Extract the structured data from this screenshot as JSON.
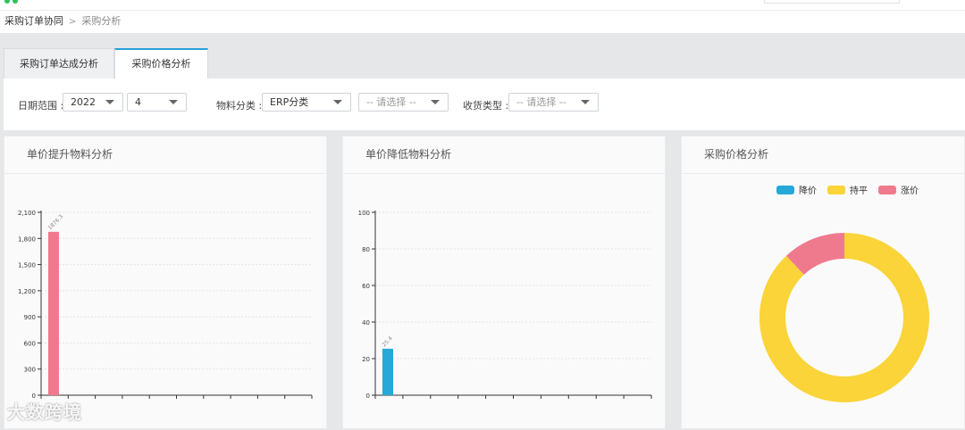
{
  "breadcrumb": {
    "parent": "采购订单协同",
    "separator": ">",
    "current": "采购分析"
  },
  "tabs": [
    {
      "label": "采购订单达成分析",
      "active": false
    },
    {
      "label": "采购价格分析",
      "active": true
    }
  ],
  "filters": {
    "date_label": "日期范围 :",
    "year": "2022",
    "month": "4",
    "material_label": "物料分类 :",
    "material_type": "ERP分类",
    "material_placeholder": "-- 请选择 --",
    "receipt_label": "收货类型 :",
    "receipt_placeholder": "-- 请选择 --"
  },
  "panels": {
    "increase": {
      "title": "单价提升物料分析"
    },
    "decrease": {
      "title": "单价降低物料分析"
    },
    "price": {
      "title": "采购价格分析"
    }
  },
  "colors": {
    "accent": "#26a2d8",
    "increase": "#f07a8d",
    "decrease": "#26a8d9",
    "flat": "#fad438"
  },
  "watermark": "大数跨境",
  "chart_data": [
    {
      "type": "bar",
      "categories": [
        "",
        "",
        "",
        "",
        "",
        "",
        "",
        "",
        "",
        ""
      ],
      "values": [
        1876.3
      ],
      "data_labels": [
        "1876.3"
      ],
      "y_ticks": [
        "0",
        "300",
        "600",
        "900",
        "1,200",
        "1,500",
        "1,800",
        "2,100"
      ],
      "ylim": [
        0,
        2100
      ],
      "color": "#f07a8d",
      "grid": true
    },
    {
      "type": "bar",
      "categories": [
        "",
        "",
        "",
        "",
        "",
        "",
        "",
        "",
        "",
        ""
      ],
      "values": [
        25.4
      ],
      "data_labels": [
        "25.4"
      ],
      "y_ticks": [
        "0",
        "20",
        "40",
        "60",
        "80",
        "100"
      ],
      "ylim": [
        0,
        100
      ],
      "color": "#26a8d9",
      "grid": true
    },
    {
      "type": "pie",
      "donut": true,
      "legend_position": "top",
      "slices": [
        {
          "name": "降价",
          "value": 0,
          "color": "#26a8d9"
        },
        {
          "name": "持平",
          "value": 88,
          "color": "#fad438"
        },
        {
          "name": "涨价",
          "value": 12,
          "color": "#f07a8d"
        }
      ]
    }
  ]
}
